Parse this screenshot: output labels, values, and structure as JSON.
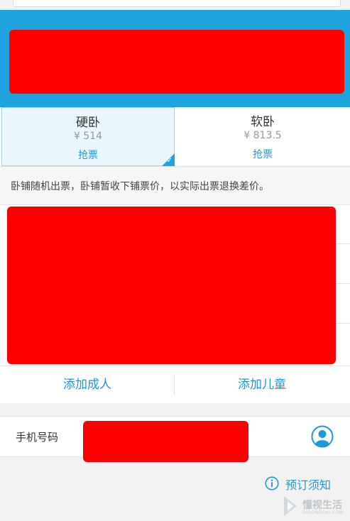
{
  "seats": [
    {
      "name": "硬卧",
      "price": "¥ 514",
      "action": "抢票",
      "selected": true
    },
    {
      "name": "软卧",
      "price": "¥ 813.5",
      "action": "抢票",
      "selected": false
    }
  ],
  "notice": "卧铺随机出票，卧铺暂收下铺票价，以实际出票退换差价。",
  "passengers": {
    "add_adult": "添加成人",
    "add_child": "添加儿童"
  },
  "contact": {
    "phone_label": "手机号码",
    "contact_icon": "contact-person-icon"
  },
  "booking_notice": {
    "label": "预订须知",
    "icon": "info-icon"
  },
  "watermark": {
    "text": "懂视生活",
    "sub": "DIDONGSHI.COM"
  },
  "colors": {
    "accent": "#1b9ad6",
    "banner": "#1ea3de",
    "redaction": "#ff0000"
  }
}
